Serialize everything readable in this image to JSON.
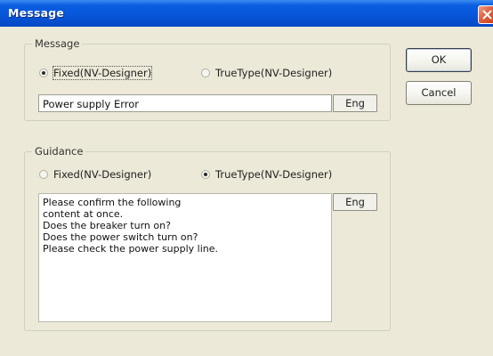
{
  "window": {
    "title": "Message",
    "close_icon": "close-icon",
    "accent_color": "#0a5ee0",
    "close_color": "#e0603e"
  },
  "message_group": {
    "label": "Message",
    "options": [
      {
        "label": "Fixed(NV-Designer)",
        "checked": true
      },
      {
        "label": "TrueType(NV-Designer)",
        "checked": false
      }
    ],
    "text_value": "Power supply Error",
    "eng_button": "Eng"
  },
  "guidance_group": {
    "label": "Guidance",
    "options": [
      {
        "label": "Fixed(NV-Designer)",
        "checked": false
      },
      {
        "label": "TrueType(NV-Designer)",
        "checked": true
      }
    ],
    "text_value": "Please confirm the following\ncontent at once.\nDoes the breaker turn on?\nDoes the power switch turn on?\nPlease check the power supply line.",
    "eng_button": "Eng"
  },
  "buttons": {
    "ok": "OK",
    "cancel": "Cancel"
  }
}
